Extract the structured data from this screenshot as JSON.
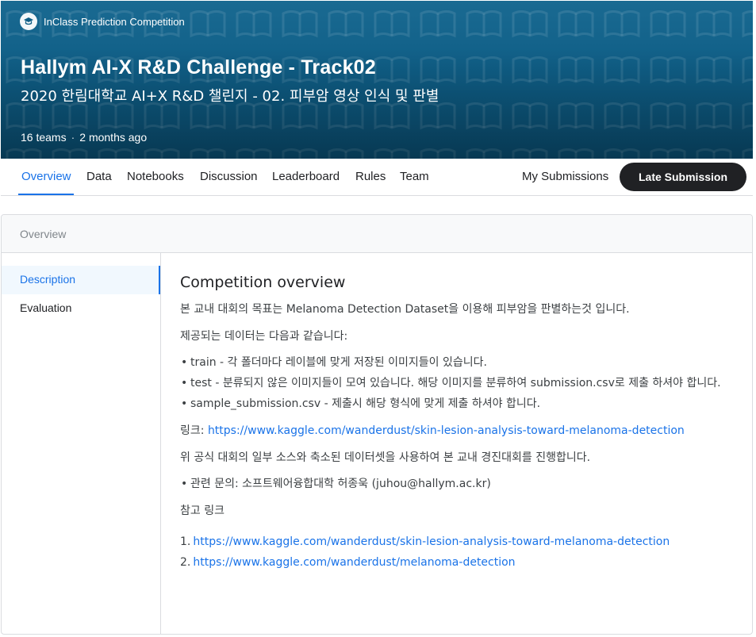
{
  "header": {
    "badge": "InClass Prediction Competition",
    "title": "Hallym AI-X R&D Challenge - Track02",
    "subtitle": "2020 한림대학교 AI+X R&D 챌린지 - 02. 피부암 영상 인식 및 판별",
    "teams": "16 teams",
    "separator": "·",
    "time": "2 months ago",
    "banner_color": "#0f5e86"
  },
  "tabs": {
    "overview": "Overview",
    "data": "Data",
    "notebooks": "Notebooks",
    "discussion": "Discussion",
    "leaderboard": "Leaderboard",
    "rules": "Rules",
    "team": "Team",
    "my_submissions": "My Submissions",
    "late_submission": "Late Submission",
    "accent": "#1a73e8"
  },
  "card": {
    "heading": "Overview",
    "sidebar": {
      "description": "Description",
      "evaluation": "Evaluation"
    }
  },
  "content": {
    "title": "Competition overview",
    "intro": "본 교내 대회의 목표는 Melanoma Detection Dataset을 이용해 피부암을 판별하는것 입니다.",
    "data_intro": "제공되는 데이터는 다음과 같습니다:",
    "bullets": [
      "train - 각 폴더마다 레이블에 맞게 저장된 이미지들이 있습니다.",
      "test - 분류되지 않은 이미지들이 모여 있습니다. 해당 이미지를 분류하여 submission.csv로 제출 하셔야 합니다.",
      "sample_submission.csv - 제출시 해당 형식에 맞게 제출 하셔야 합니다."
    ],
    "link_label": "링크: ",
    "link_url": "https://www.kaggle.com/wanderdust/skin-lesion-analysis-toward-melanoma-detection",
    "note": "위 공식 대회의 일부 소스와 축소된 데이터셋을 사용하여 본 교내 경진대회를 진행합니다.",
    "contact": "관련 문의: 소프트웨어융합대학 허종욱 (juhou@hallym.ac.kr)",
    "refs_title": "참고 링크",
    "refs": [
      {
        "num": "1.",
        "url": "https://www.kaggle.com/wanderdust/skin-lesion-analysis-toward-melanoma-detection"
      },
      {
        "num": "2.",
        "url": "https://www.kaggle.com/wanderdust/melanoma-detection"
      }
    ]
  }
}
